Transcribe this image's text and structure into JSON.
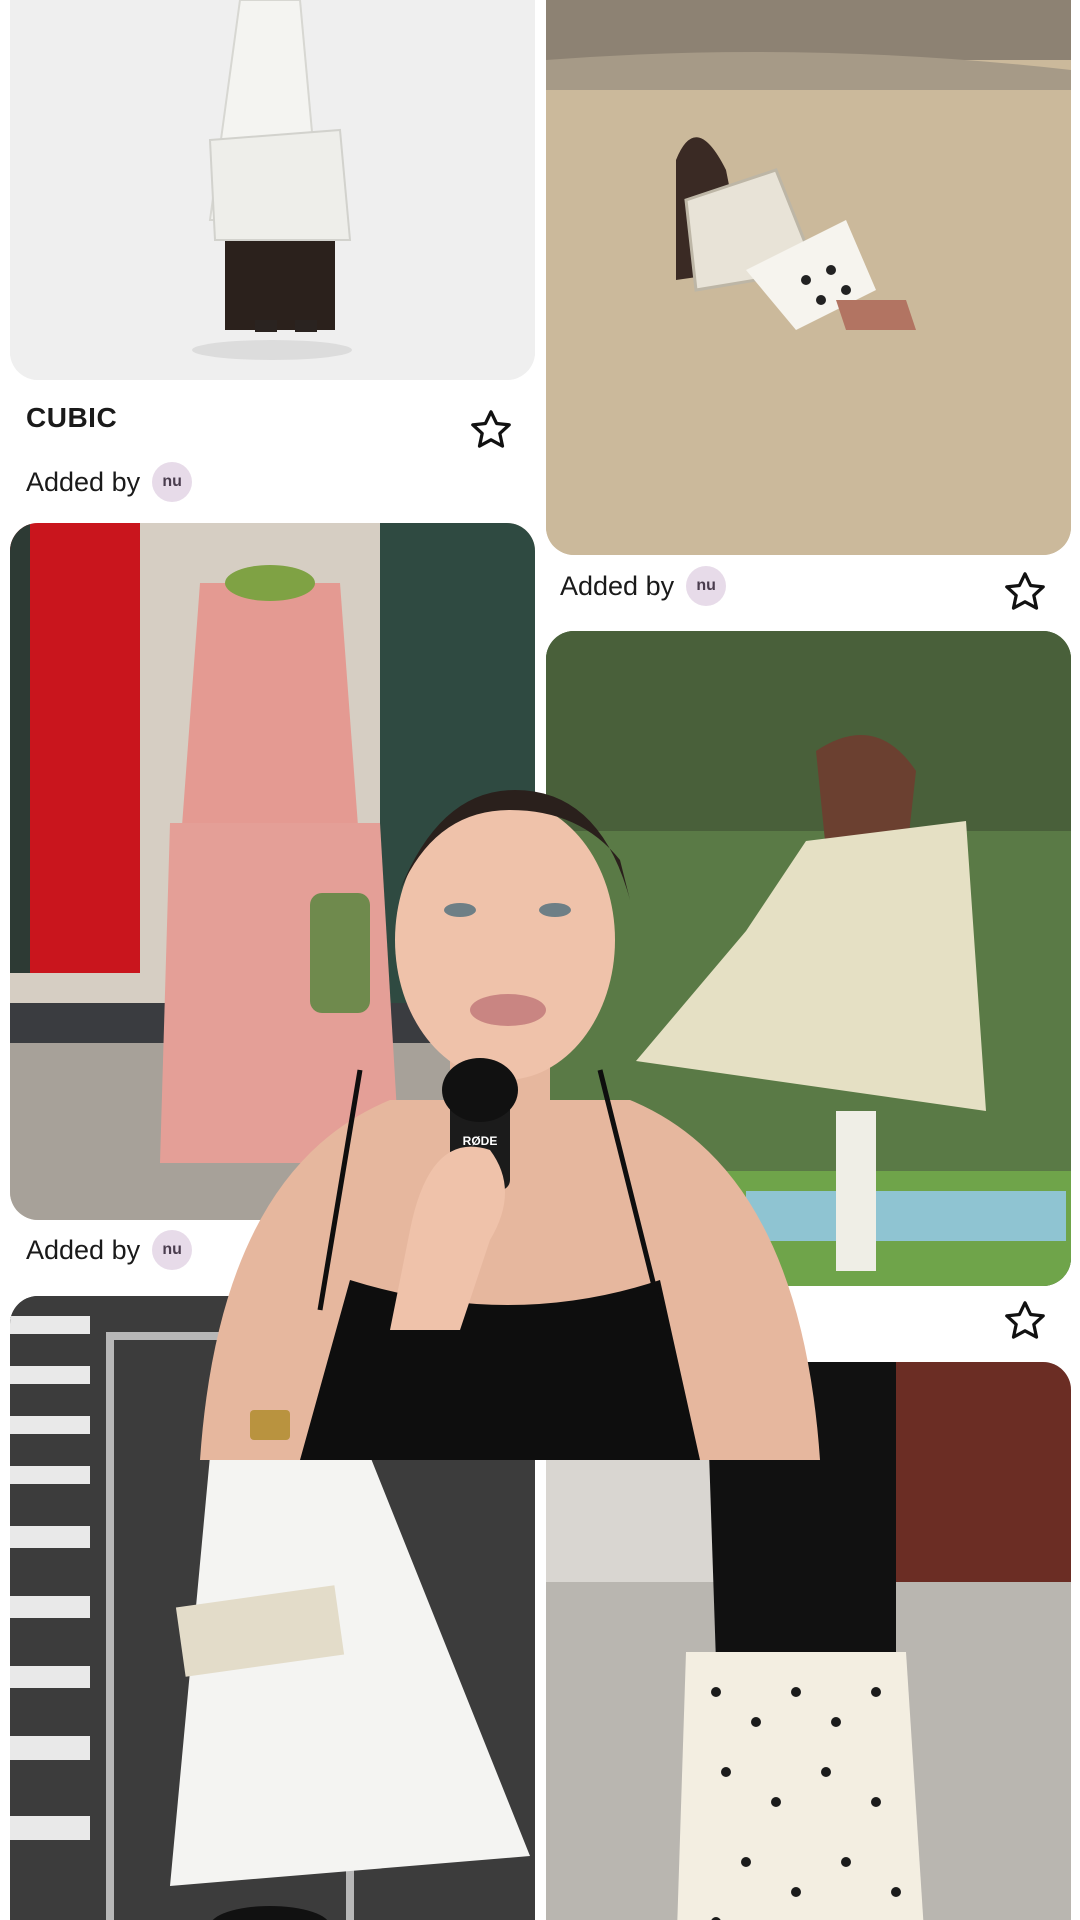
{
  "cards": [
    {
      "id": "white-dress",
      "brand": "CUBIC",
      "added_by_label": "Added by",
      "user_badge": "nu",
      "favorite_icon": "star-outline-icon"
    },
    {
      "id": "beach",
      "added_by_label": "Added by",
      "user_badge": "nu",
      "favorite_icon": "star-outline-icon"
    },
    {
      "id": "plaid-dress",
      "added_by_label": "Added by",
      "user_badge": "nu"
    },
    {
      "id": "trench-coat",
      "favorite_icon": "star-outline-icon"
    },
    {
      "id": "white-skirt"
    },
    {
      "id": "polka-skirt"
    }
  ],
  "overlay": {
    "mic_brand": "RØDE"
  },
  "colors": {
    "star_stroke": "#111111",
    "avatar_bg": "#e7dbe9",
    "text": "#1a1a1a"
  }
}
